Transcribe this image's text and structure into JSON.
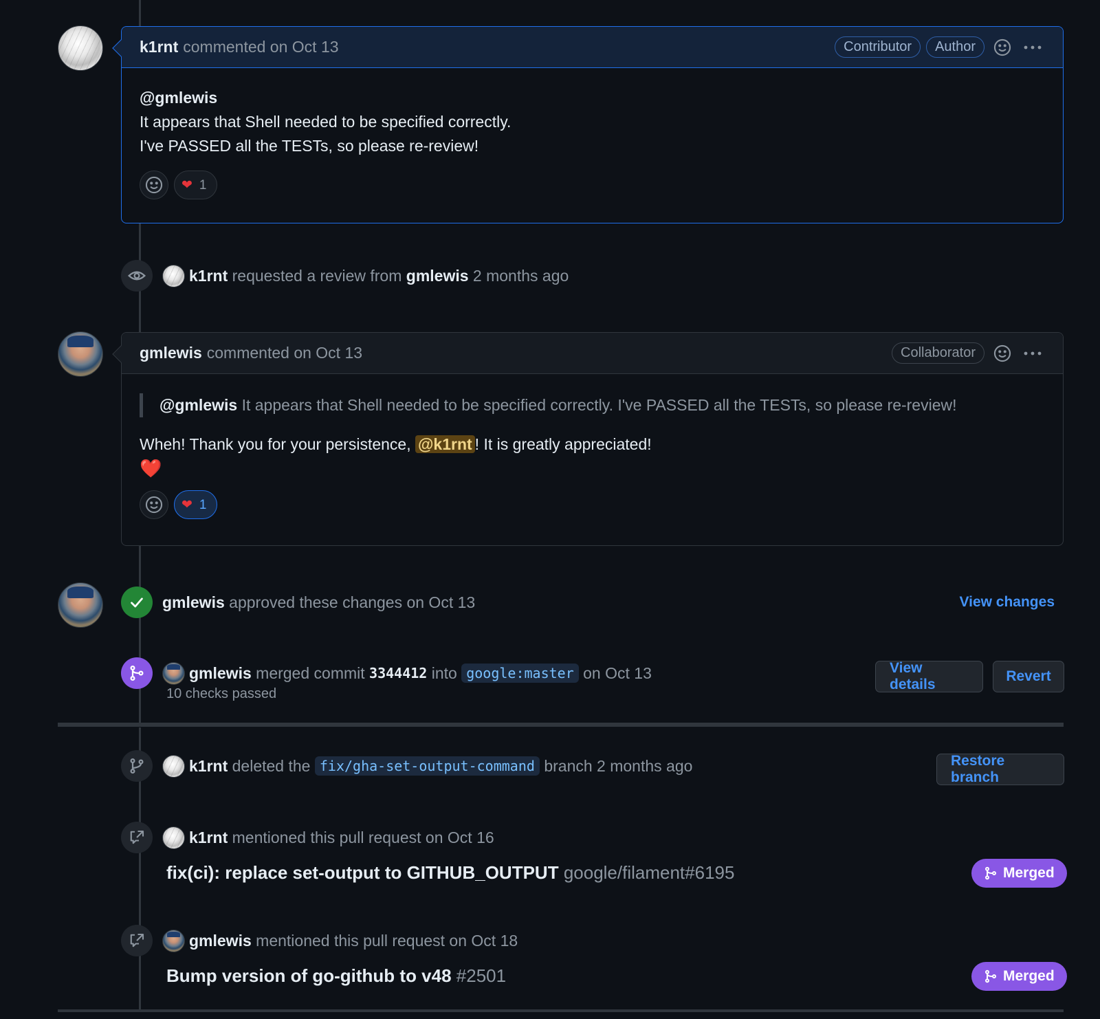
{
  "comment1": {
    "author": "k1rnt",
    "meta": "commented on Oct 13",
    "badges": [
      "Contributor",
      "Author"
    ],
    "body_lines": [
      "@gmlewis",
      "It appears that Shell needed to be specified correctly.",
      "I've PASSED all the TESTs, so please re-review!"
    ],
    "reaction_count": "1"
  },
  "review_request": {
    "actor": "k1rnt",
    "text": "requested a review from",
    "reviewer": "gmlewis",
    "time": "2 months ago"
  },
  "comment2": {
    "author": "gmlewis",
    "meta": "commented on Oct 13",
    "badge": "Collaborator",
    "quote_mention": "@gmlewis",
    "quote_text": "It appears that Shell needed to be specified correctly. I've PASSED all the TESTs, so please re-review!",
    "reply_before": "Wheh! Thank you for your persistence,",
    "reply_mention": "@k1rnt",
    "reply_after": "! It is greatly appreciated!",
    "reply_emoji": "❤️",
    "reaction_count": "1"
  },
  "approval": {
    "actor": "gmlewis",
    "text": "approved these changes on Oct 13",
    "link": "View changes"
  },
  "merge": {
    "actor": "gmlewis",
    "text1": "merged commit",
    "sha": "3344412",
    "text2": "into",
    "branch": "google:master",
    "text3": "on Oct 13",
    "checks": "10 checks passed",
    "view_details": "View details",
    "revert": "Revert"
  },
  "delete_branch": {
    "actor": "k1rnt",
    "text1": "deleted the",
    "branch": "fix/gha-set-output-command",
    "text2": "branch 2 months ago",
    "button": "Restore branch"
  },
  "mention1": {
    "actor": "k1rnt",
    "text": "mentioned this pull request on Oct 16",
    "title": "fix(ci): replace set-output to GITHUB_OUTPUT",
    "ref": "google/filament#6195",
    "status": "Merged"
  },
  "mention2": {
    "actor": "gmlewis",
    "text": "mentioned this pull request on Oct 18",
    "title": "Bump version of go-github to v48",
    "ref": "#2501",
    "status": "Merged"
  },
  "colors": {
    "background": "#0d1117",
    "accent_blue": "#4493f8",
    "approve_green": "#238636",
    "merged_purple": "#8957e5"
  }
}
